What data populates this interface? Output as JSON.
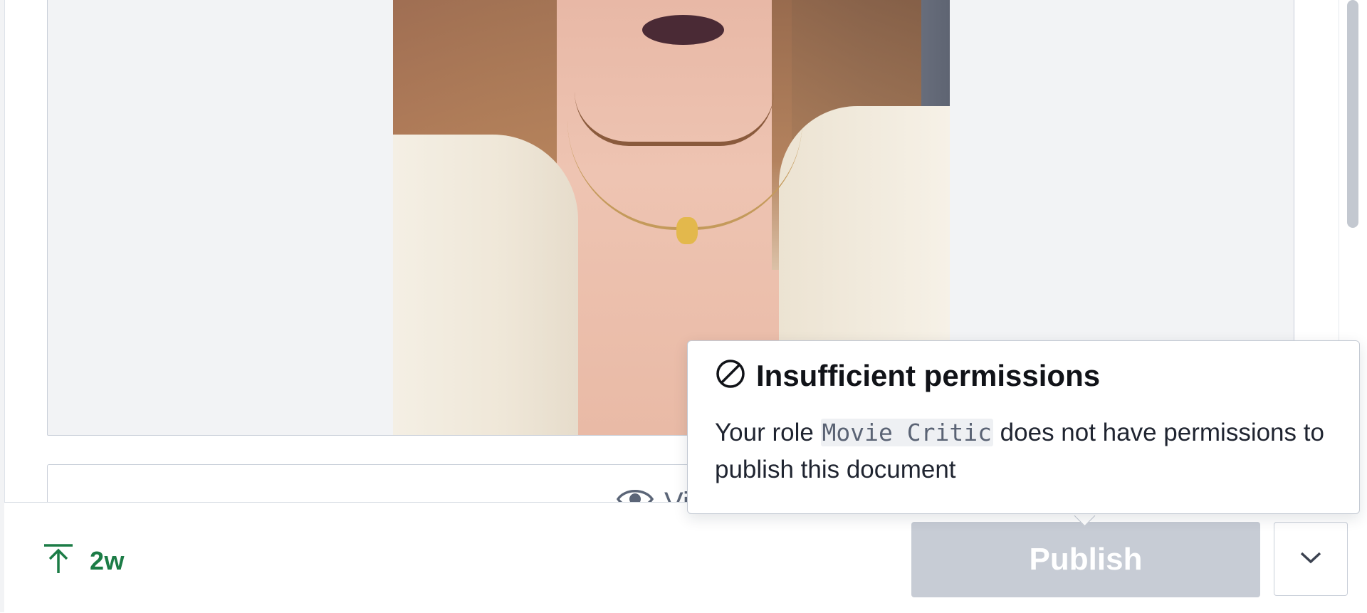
{
  "footer": {
    "status_text": "2w",
    "publish_label": "Publish",
    "colors": {
      "status": "#1c7c46",
      "publish_disabled": "#c7ccd5"
    }
  },
  "view_button": {
    "label": "View"
  },
  "tooltip": {
    "title": "Insufficient permissions",
    "body_before": "Your role ",
    "role": "Movie Critic",
    "body_after": " does not have permissions to publish this document"
  },
  "icons": {
    "status": "arrow-up-to-line-icon",
    "menu": "chevron-down-icon",
    "view": "eye-icon",
    "tooltip": "ban-icon"
  }
}
